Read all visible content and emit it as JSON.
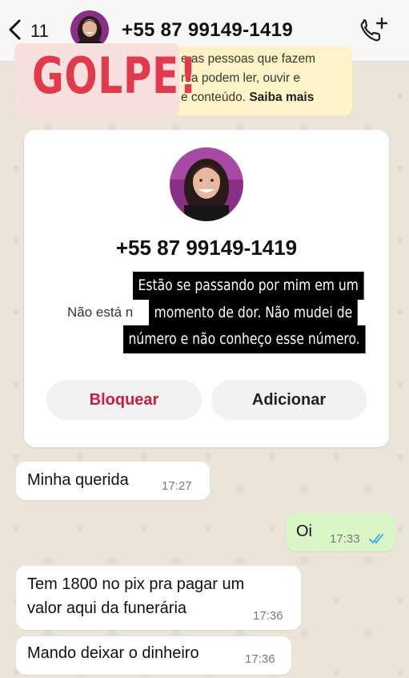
{
  "header": {
    "back_count": "11",
    "contact_number": "+55 87 99149-1419",
    "icons": {
      "back": "chevron-left-icon",
      "call": "phone-add-icon",
      "avatar": "avatar"
    }
  },
  "notice": {
    "text_lines": "e as pessoas que fazem\nrsa podem ler, ouvir e\ne conteúdo. ",
    "link": "Saiba mais"
  },
  "overlay_stamp": "GOLPE!",
  "card": {
    "number": "+55 87 99149-1419",
    "status_partial": "Não está n",
    "block_label": "Bloquear",
    "add_label": "Adicionar"
  },
  "caption": {
    "line1": "Estão se passando por mim em um",
    "line2": "momento de dor. Não mudei de",
    "line3": "número e não conheço esse número."
  },
  "messages": [
    {
      "direction": "in",
      "text": "Minha querida",
      "time": "17:27"
    },
    {
      "direction": "out",
      "text": "Oi",
      "time": "17:33",
      "status": "read"
    },
    {
      "direction": "in",
      "text": "Tem 1800 no pix pra pagar um\nvalor aqui da funerária",
      "time": "17:36"
    },
    {
      "direction": "in",
      "text": "Mando deixar o dinheiro",
      "time": "17:36"
    }
  ],
  "colors": {
    "block": "#c81d3e",
    "stamp": "#e23a4d",
    "outgoing_bubble": "#d9f6c6",
    "read_ticks": "#3aa7e8"
  }
}
